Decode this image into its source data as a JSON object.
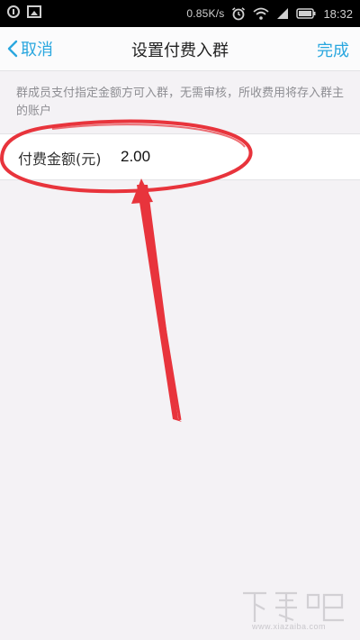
{
  "status_bar": {
    "net_speed": "0.85K/s",
    "time": "18:32"
  },
  "header": {
    "back_label": "取消",
    "title": "设置付费入群",
    "done_label": "完成"
  },
  "description": "群成员支付指定金额方可入群，无需审核，所收费用将存入群主的账户",
  "amount": {
    "label": "付费金额(元)",
    "value": "2.00"
  },
  "watermark": {
    "text": "下载吧",
    "url": "www.xiazaiba.com"
  },
  "colors": {
    "accent": "#2aa7df",
    "annotation": "#e8343c",
    "background": "#f4f2f5"
  },
  "icons": [
    "alert-icon",
    "image-icon",
    "alarm-icon",
    "wifi-icon",
    "signal-icon",
    "battery-icon",
    "back-chevron-icon"
  ]
}
